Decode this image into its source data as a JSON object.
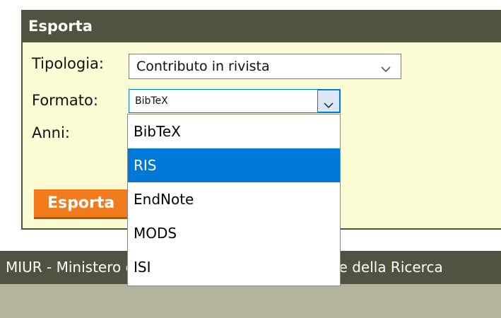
{
  "panel": {
    "title": "Esporta"
  },
  "form": {
    "tipologia_label": "Tipologia:",
    "tipologia_value": "Contributo in rivista",
    "formato_label": "Formato:",
    "formato_value": "BibTeX",
    "anni_label": "Anni:",
    "submit_label": "Esporta"
  },
  "dropdown": {
    "options": [
      "BibTeX",
      "RIS",
      "EndNote",
      "MODS",
      "ISI"
    ],
    "highlighted": "RIS"
  },
  "footer": {
    "text": "MIUR - Ministero dell'Istruzione, dell'Università e della Ricerca"
  },
  "colors": {
    "header_bg": "#4f533f",
    "panel_bg": "#fcfcd4",
    "accent_orange": "#f07c1e",
    "highlight_blue": "#0078d7",
    "bottom_bg": "#b3b49d"
  }
}
